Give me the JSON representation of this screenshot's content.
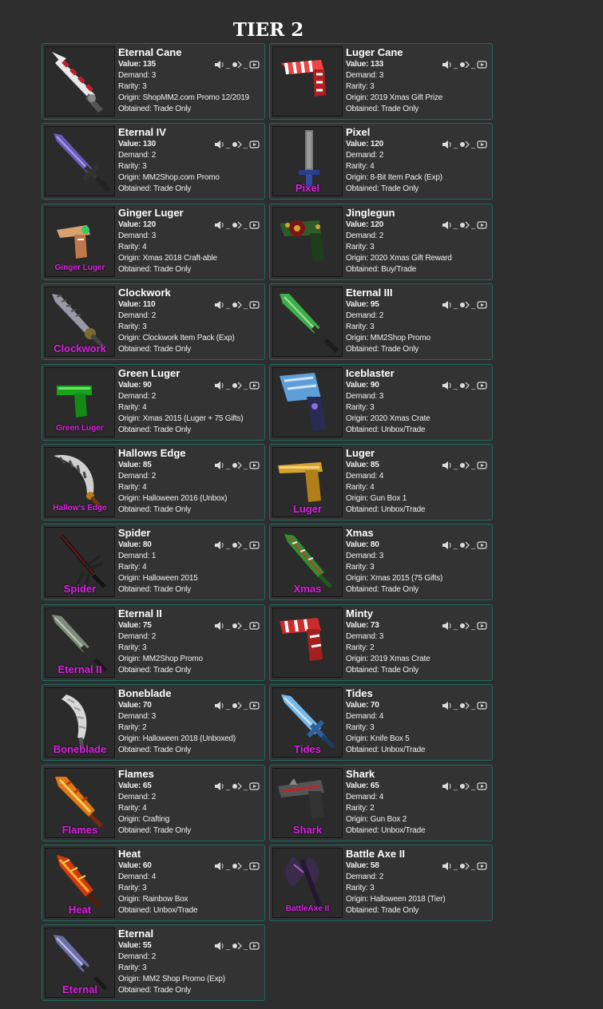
{
  "page": {
    "title": "TIER 2"
  },
  "labels": {
    "value": "Value: ",
    "demand": "Demand: ",
    "rarity": "Rarity: ",
    "origin": "Origin: ",
    "obtained": "Obtained: ",
    "separator": "_"
  },
  "colors": {
    "background": "#2e2e2e",
    "card_border": "#1d6b5e",
    "label_text": "#e020e8"
  },
  "items": [
    {
      "name": "Eternal Cane",
      "value": "135",
      "demand": "3",
      "rarity": "3",
      "origin": "ShopMM2.com Promo 12/2019",
      "obtained": "Trade Only",
      "thumb_label": "",
      "kind": "cane"
    },
    {
      "name": "Luger Cane",
      "value": "133",
      "demand": "3",
      "rarity": "3",
      "origin": "2019 Xmas Gift Prize",
      "obtained": "Trade Only",
      "thumb_label": "",
      "kind": "gun-cane"
    },
    {
      "name": "Eternal IV",
      "value": "130",
      "demand": "2",
      "rarity": "3",
      "origin": "MM2Shop.com Promo",
      "obtained": "Trade Only",
      "thumb_label": "",
      "kind": "sword-purple"
    },
    {
      "name": "Pixel",
      "value": "120",
      "demand": "2",
      "rarity": "4",
      "origin": "8-Bit Item Pack (Exp)",
      "obtained": "Trade Only",
      "thumb_label": "Pixel",
      "kind": "pixel"
    },
    {
      "name": "Ginger Luger",
      "value": "120",
      "demand": "3",
      "rarity": "4",
      "origin": "Xmas 2018 Craft-able",
      "obtained": "Trade Only",
      "thumb_label": "Ginger Luger",
      "kind": "gun-ginger"
    },
    {
      "name": "Jinglegun",
      "value": "120",
      "demand": "2",
      "rarity": "3",
      "origin": "2020 Xmas Gift Reward",
      "obtained": "Buy/Trade",
      "thumb_label": "",
      "kind": "gun-jingle"
    },
    {
      "name": "Clockwork",
      "value": "110",
      "demand": "2",
      "rarity": "3",
      "origin": "Clockwork Item Pack (Exp)",
      "obtained": "Trade Only",
      "thumb_label": "Clockwork",
      "kind": "sword-clock"
    },
    {
      "name": "Eternal III",
      "value": "95",
      "demand": "2",
      "rarity": "3",
      "origin": "MM2Shop Promo",
      "obtained": "Trade Only",
      "thumb_label": "",
      "kind": "sword-green"
    },
    {
      "name": "Green Luger",
      "value": "90",
      "demand": "2",
      "rarity": "4",
      "origin": "Xmas 2015 (Luger + 75 Gifts)",
      "obtained": "Trade Only",
      "thumb_label": "Green Luger",
      "kind": "gun-green"
    },
    {
      "name": "Iceblaster",
      "value": "90",
      "demand": "3",
      "rarity": "3",
      "origin": "2020 Xmas Crate",
      "obtained": "Unbox/Trade",
      "thumb_label": "",
      "kind": "gun-ice"
    },
    {
      "name": "Hallows Edge",
      "value": "85",
      "demand": "2",
      "rarity": "4",
      "origin": "Halloween 2016 (Unbox)",
      "obtained": "Trade Only",
      "thumb_label": "Hallow's Edge",
      "kind": "blade-hallow"
    },
    {
      "name": "Luger",
      "value": "85",
      "demand": "4",
      "rarity": "4",
      "origin": "Gun Box 1",
      "obtained": "Unbox/Trade",
      "thumb_label": "Luger",
      "kind": "gun-gold"
    },
    {
      "name": "Spider",
      "value": "80",
      "demand": "1",
      "rarity": "4",
      "origin": "Halloween 2015",
      "obtained": "Trade Only",
      "thumb_label": "Spider",
      "kind": "knife-spider"
    },
    {
      "name": "Xmas",
      "value": "80",
      "demand": "3",
      "rarity": "3",
      "origin": "Xmas 2015 (75 Gifts)",
      "obtained": "Trade Only",
      "thumb_label": "Xmas",
      "kind": "knife-xmas"
    },
    {
      "name": "Eternal II",
      "value": "75",
      "demand": "2",
      "rarity": "3",
      "origin": "MM2Shop Promo",
      "obtained": "Trade Only",
      "thumb_label": "Eternal II",
      "kind": "sword-eternal2"
    },
    {
      "name": "Minty",
      "value": "73",
      "demand": "3",
      "rarity": "2",
      "origin": "2019 Xmas Crate",
      "obtained": "Trade Only",
      "thumb_label": "",
      "kind": "gun-minty"
    },
    {
      "name": "Boneblade",
      "value": "70",
      "demand": "3",
      "rarity": "2",
      "origin": "Halloween 2018 (Unboxed)",
      "obtained": "Trade Only",
      "thumb_label": "Boneblade",
      "kind": "blade-bone"
    },
    {
      "name": "Tides",
      "value": "70",
      "demand": "4",
      "rarity": "3",
      "origin": "Knife Box 5",
      "obtained": "Unbox/Trade",
      "thumb_label": "Tides",
      "kind": "sword-tides"
    },
    {
      "name": "Flames",
      "value": "65",
      "demand": "2",
      "rarity": "4",
      "origin": "Crafting",
      "obtained": "Trade Only",
      "thumb_label": "Flames",
      "kind": "blade-flames"
    },
    {
      "name": "Shark",
      "value": "65",
      "demand": "4",
      "rarity": "2",
      "origin": "Gun Box 2",
      "obtained": "Unbox/Trade",
      "thumb_label": "Shark",
      "kind": "gun-shark"
    },
    {
      "name": "Heat",
      "value": "60",
      "demand": "4",
      "rarity": "3",
      "origin": "Rainbow Box",
      "obtained": "Unbox/Trade",
      "thumb_label": "Heat",
      "kind": "blade-heat"
    },
    {
      "name": "Battle Axe II",
      "value": "58",
      "demand": "2",
      "rarity": "3",
      "origin": "Halloween 2018 (Tier)",
      "obtained": "Trade Only",
      "thumb_label": "BattleAxe II",
      "kind": "axe"
    },
    {
      "name": "Eternal",
      "value": "55",
      "demand": "2",
      "rarity": "3",
      "origin": "MM2 Shop Promo (Exp)",
      "obtained": "Trade Only",
      "thumb_label": "Eternal",
      "kind": "sword-eternal"
    }
  ]
}
